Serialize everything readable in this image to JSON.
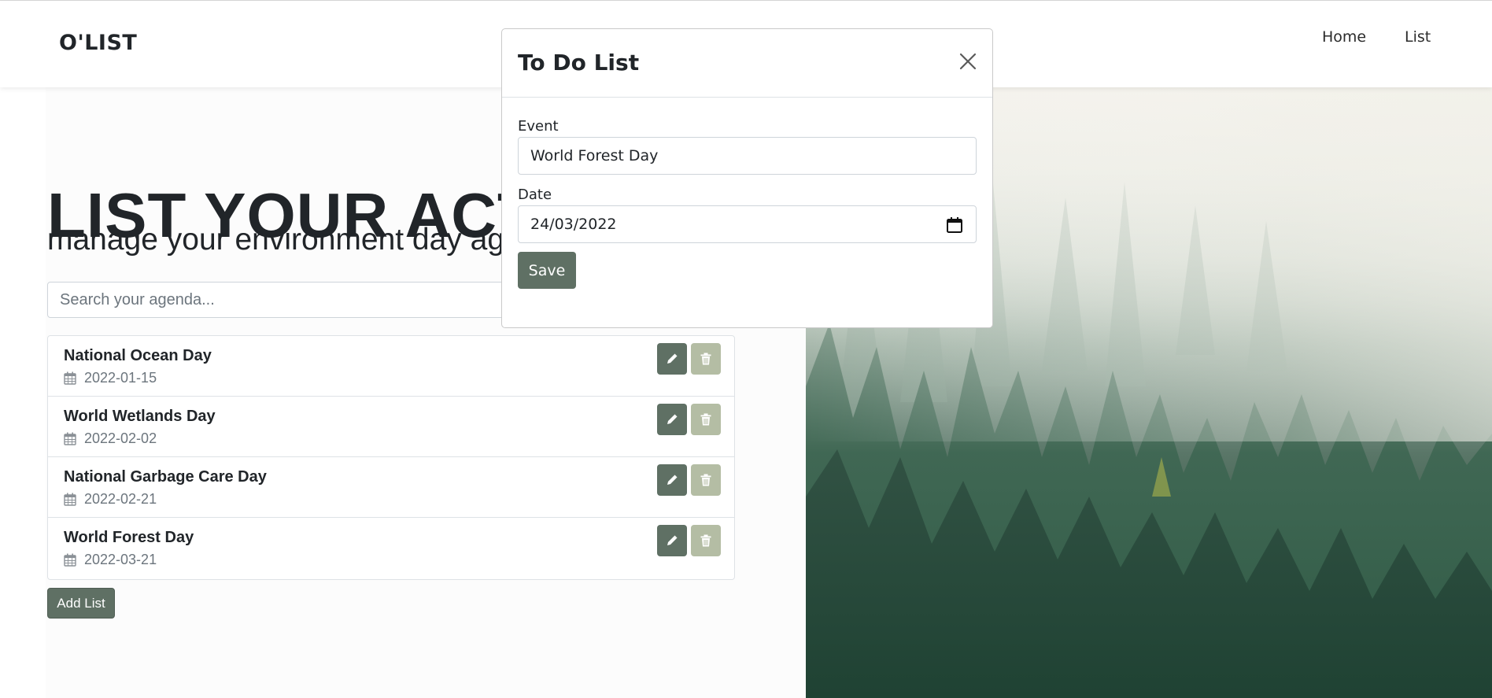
{
  "nav": {
    "brand": "O'LIST",
    "links": [
      {
        "label": "Home"
      },
      {
        "label": "List"
      }
    ]
  },
  "hero": {
    "title": "LIST YOUR ACTIVITY",
    "subtitle": "manage your environment day agenda"
  },
  "search": {
    "placeholder": "Search your agenda..."
  },
  "agenda": {
    "items": [
      {
        "title": "National Ocean Day",
        "date": "2022-01-15"
      },
      {
        "title": "World Wetlands Day",
        "date": "2022-02-02"
      },
      {
        "title": "National Garbage Care Day",
        "date": "2022-02-21"
      },
      {
        "title": "World Forest Day",
        "date": "2022-03-21"
      }
    ],
    "add_label": "Add List"
  },
  "modal": {
    "title": "To Do List",
    "event_label": "Event",
    "event_value": "World Forest Day",
    "date_label": "Date",
    "date_value": "24/03/2022",
    "save_label": "Save"
  },
  "colors": {
    "primary_button": "#5f7064",
    "delete_button": "#b4bda4"
  }
}
